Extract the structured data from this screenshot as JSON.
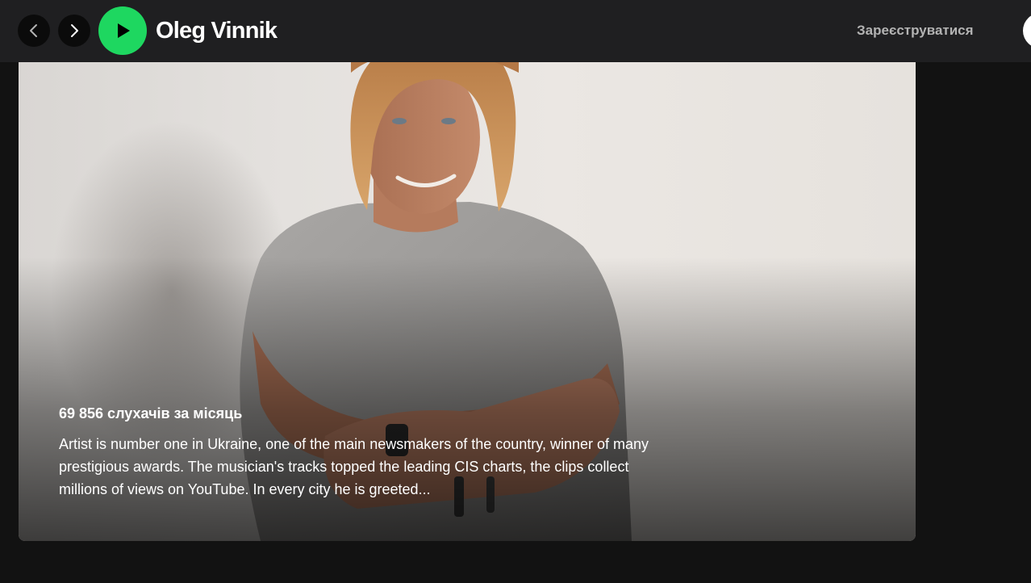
{
  "header": {
    "artist_name": "Oleg Vinnik",
    "signup_label": "Зареєструватися",
    "icons": {
      "back": "chevron-left-icon",
      "forward": "chevron-right-icon",
      "play": "play-icon"
    },
    "colors": {
      "bar_bg": "#1f1f21",
      "play_green": "#1ed760",
      "signup_text": "#b3b3b3"
    }
  },
  "about": {
    "monthly_listeners": "69 856 слухачів за місяць",
    "bio": "Artist is number one in Ukraine, one of the main newsmakers of the country, winner of many prestigious awards. The musician's tracks topped the leading CIS charts, the clips collect millions of views on YouTube. In every city he is greeted..."
  }
}
